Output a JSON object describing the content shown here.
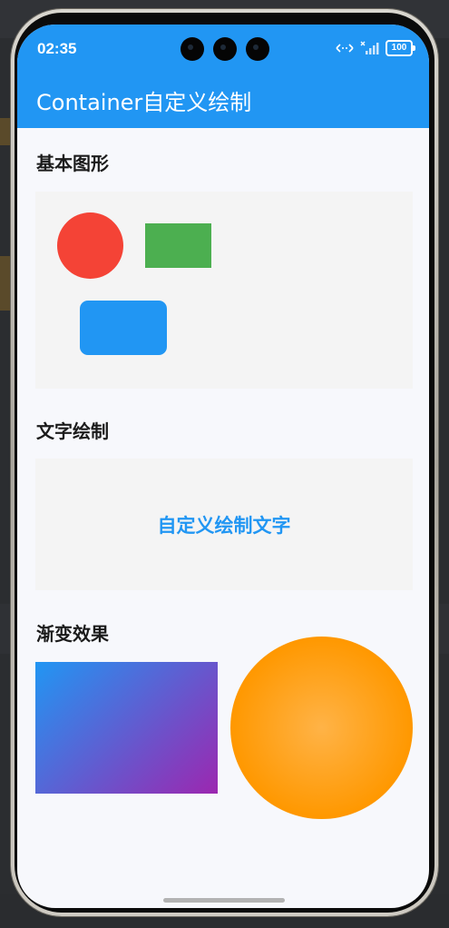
{
  "status_bar": {
    "time": "02:35",
    "battery": "100",
    "icons": [
      "data-transfer-icon",
      "no-signal-icon",
      "battery-icon"
    ]
  },
  "app_bar": {
    "title": "Container自定义绘制"
  },
  "sections": {
    "basic_shapes": {
      "title": "基本图形",
      "shapes": [
        {
          "kind": "circle",
          "color": "#f44336"
        },
        {
          "kind": "rectangle",
          "color": "#4caf50"
        },
        {
          "kind": "rounded-rectangle",
          "color": "#2196f3"
        }
      ]
    },
    "text_drawing": {
      "title": "文字绘制",
      "text": "自定义绘制文字",
      "text_color": "#2196f3"
    },
    "gradient": {
      "title": "渐变效果",
      "linear_gradient": {
        "from": "#2196f3",
        "to": "#9c27b0"
      },
      "radial_gradient": {
        "center": "#ffb347",
        "edge": "#ff9800"
      }
    }
  },
  "colors": {
    "primary": "#2196f3",
    "background": "#f7f8fc",
    "card": "#f4f4f4"
  }
}
